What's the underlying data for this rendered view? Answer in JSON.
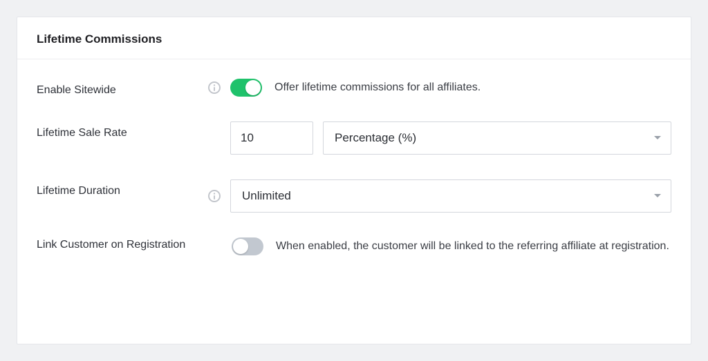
{
  "card": {
    "title": "Lifetime Commissions"
  },
  "enable_sitewide": {
    "label": "Enable Sitewide",
    "enabled": true,
    "description": "Offer lifetime commissions for all affiliates."
  },
  "lifetime_sale_rate": {
    "label": "Lifetime Sale Rate",
    "value": "10",
    "rate_type": "Percentage (%)"
  },
  "lifetime_duration": {
    "label": "Lifetime Duration",
    "value": "Unlimited"
  },
  "link_customer": {
    "label": "Link Customer on Registration",
    "enabled": false,
    "description": "When enabled, the customer will be linked to the referring affiliate at registration."
  }
}
